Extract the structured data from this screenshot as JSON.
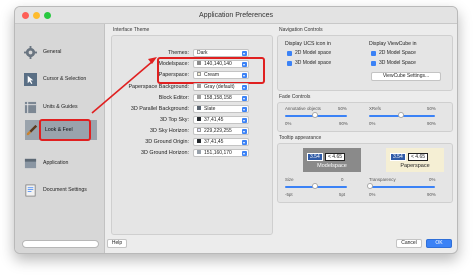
{
  "window": {
    "title": "Application Preferences"
  },
  "sidebar": {
    "items": [
      {
        "label": "General",
        "icon": "gear-icon"
      },
      {
        "label": "Cursor & Selection",
        "icon": "cursor-icon"
      },
      {
        "label": "Units & Guides",
        "icon": "ruler-icon"
      },
      {
        "label": "Look & Feel",
        "icon": "paintbrush-icon"
      },
      {
        "label": "Application",
        "icon": "app-icon"
      },
      {
        "label": "Document Settings",
        "icon": "document-icon"
      }
    ]
  },
  "interface_theme": {
    "label": "Interface Theme",
    "rows": [
      {
        "label": "Themes:",
        "value": "Dark"
      },
      {
        "label": "Modelspace:",
        "value": "140,140,140",
        "swatch": "#8c8c8c"
      },
      {
        "label": "Paperspace:",
        "value": "Cream",
        "swatch": "#f5efd4"
      },
      {
        "label": "Paperspace Background:",
        "value": "Gray (default)",
        "swatch": "#9e9e9e"
      },
      {
        "label": "Block Editor:",
        "value": "158,158,158",
        "swatch": "#9e9e9e"
      },
      {
        "label": "3D Parallel Background:",
        "value": "Slate",
        "swatch": "#5a6470"
      },
      {
        "label": "3D Top Sky:",
        "value": "37,41,45",
        "swatch": "#25292d"
      },
      {
        "label": "3D Sky Horizon:",
        "value": "229,229,255",
        "swatch": "#e5e5ff"
      },
      {
        "label": "3D Ground Origin:",
        "value": "37,41,45",
        "swatch": "#25292d"
      },
      {
        "label": "3D Ground Horizon:",
        "value": "151,160,170",
        "swatch": "#97a0aa"
      }
    ]
  },
  "navigation_controls": {
    "label": "Navigation Controls",
    "ucs_label": "Display UCS icon in",
    "viewcube_label": "Display ViewCube in",
    "ucs_2d": "2D Model space",
    "ucs_3d": "3D Model space",
    "vc_2d": "2D Model Space",
    "vc_3d": "3D Model Space",
    "settings_button": "ViewCube Settings..."
  },
  "fade_controls": {
    "label": "Fade Controls",
    "annotative_label": "Annotative objects",
    "annotative_value": "50%",
    "xrefs_label": "XRefs",
    "xrefs_value": "50%",
    "min": "0%",
    "max": "90%"
  },
  "tooltip_appearance": {
    "label": "Tooltip appearance",
    "modelspace_caption": "Modelspace",
    "paperspace_caption": "Paperspace",
    "tip_value": "3.54",
    "tip_compare": "< 4.65",
    "size_label": "Size",
    "size_value": "0",
    "size_min": "-5pt",
    "size_max": "5pt",
    "transparency_label": "Transparency",
    "transparency_value": "0%",
    "transparency_min": "0%",
    "transparency_max": "90%"
  },
  "buttons": {
    "help": "Help",
    "cancel": "Cancel",
    "ok": "OK"
  },
  "colors": {
    "accent": "#3b82f6",
    "annotation_red": "#e02020"
  }
}
